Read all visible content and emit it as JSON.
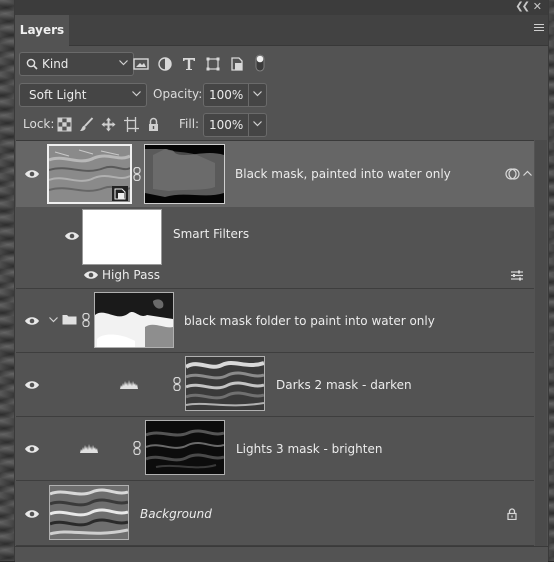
{
  "window": {
    "tab_label": "Layers"
  },
  "filter": {
    "kind_value": "Kind",
    "filter_icons": [
      "image-filter-icon",
      "adjustment-filter-icon",
      "type-filter-icon",
      "shape-filter-icon",
      "smart-object-filter-icon",
      "filter-toggle-icon"
    ]
  },
  "blend": {
    "mode_value": "Soft Light",
    "opacity_label": "Opacity:",
    "opacity_value": "100%"
  },
  "lock": {
    "label": "Lock:",
    "icons": [
      "lock-transparent-icon",
      "lock-image-icon",
      "lock-position-icon",
      "lock-artboard-icon",
      "lock-all-icon"
    ],
    "fill_label": "Fill:",
    "fill_value": "100%"
  },
  "layers": [
    {
      "name": "Black mask, painted into water only",
      "selected": true,
      "has_smart_filters": true,
      "smart_filters_label": "Smart Filters",
      "filter_name": "High Pass"
    },
    {
      "name": "black mask folder to paint into water only",
      "type": "group"
    },
    {
      "name": "Darks 2 mask - darken",
      "type": "levels-adjustment"
    },
    {
      "name": "Lights 3 mask - brighten",
      "type": "levels-adjustment"
    },
    {
      "name": "Background",
      "type": "background",
      "locked": true
    }
  ],
  "colors": {
    "panel": "#535353",
    "selected_row": "#666666",
    "text": "#ececec"
  }
}
